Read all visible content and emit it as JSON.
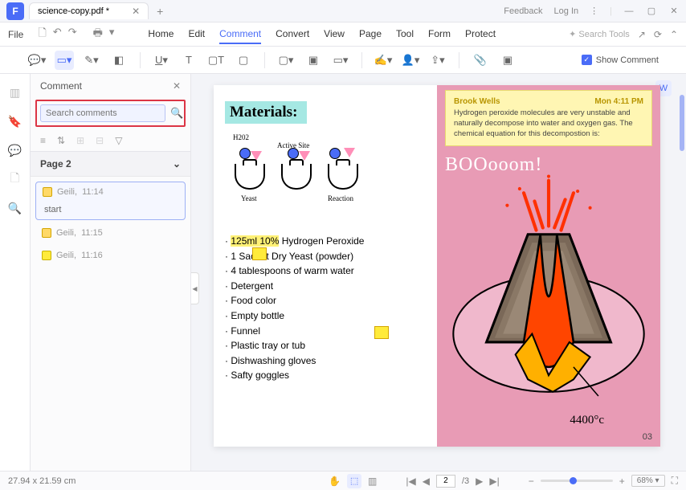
{
  "app": {
    "logo": "F",
    "tabTitle": "science-copy.pdf *"
  },
  "titlebar": {
    "feedback": "Feedback",
    "login": "Log In"
  },
  "menubar": {
    "file": "File",
    "items": [
      "Home",
      "Edit",
      "Comment",
      "Convert",
      "View",
      "Page",
      "Tool",
      "Form",
      "Protect"
    ],
    "active": "Comment",
    "searchPlaceholder": "Search Tools"
  },
  "toolbar": {
    "showComment": "Show Comment"
  },
  "panel": {
    "title": "Comment",
    "searchPlaceholder": "Search comments",
    "pageLabel": "Page 2",
    "comments": [
      {
        "user": "Geili,",
        "time": "11:14",
        "text": "start",
        "type": "note"
      },
      {
        "user": "Geili,",
        "time": "11:15",
        "text": "",
        "type": "note"
      },
      {
        "user": "Geili,",
        "time": "11:16",
        "text": "",
        "type": "hl"
      }
    ]
  },
  "doc": {
    "materialsHeading": "Materials:",
    "diag": {
      "h202": "H202",
      "activeSite": "Active Site",
      "yeast": "Yeast",
      "reaction": "Reaction"
    },
    "materials": [
      {
        "text": "125ml 10% Hydrogen Peroxide",
        "hl": "125ml 10%"
      },
      {
        "text": "1 Sachet Dry Yeast (powder)"
      },
      {
        "text": "4 tablespoons of warm water"
      },
      {
        "text": "Detergent"
      },
      {
        "text": "Food color"
      },
      {
        "text": "Empty bottle"
      },
      {
        "text": "Funnel"
      },
      {
        "text": "Plastic tray or tub"
      },
      {
        "text": "Dishwashing gloves"
      },
      {
        "text": "Safty goggles"
      }
    ],
    "sticky": {
      "author": "Brook Wells",
      "time": "Mon 4:11 PM",
      "body": "Hydrogen peroxide molecules are very unstable and naturally decompose into water and oxygen gas. The chemical equation for this decompostion is:"
    },
    "boom": "BOOooom!",
    "temp": "4400°c",
    "pageNum": "03"
  },
  "status": {
    "dims": "27.94 x 21.59 cm",
    "pageCurrent": "2",
    "pageTotal": "/3",
    "zoom": "68%"
  }
}
